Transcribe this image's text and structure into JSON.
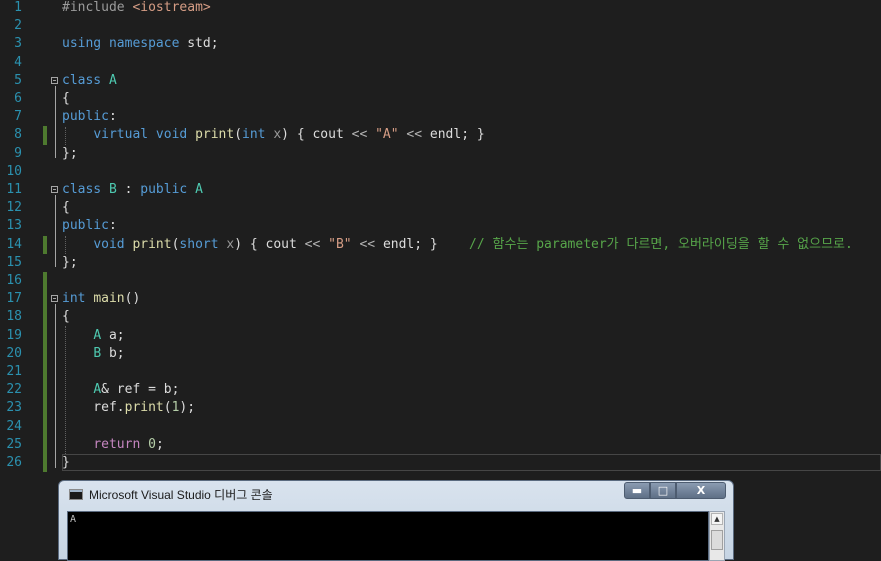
{
  "editor": {
    "line_numbers": [
      "1",
      "2",
      "3",
      "4",
      "5",
      "6",
      "7",
      "8",
      "9",
      "10",
      "11",
      "12",
      "13",
      "14",
      "15",
      "16",
      "17",
      "18",
      "19",
      "20",
      "21",
      "22",
      "23",
      "24",
      "25",
      "26"
    ],
    "lines": [
      [
        {
          "t": "#include ",
          "c": "pp"
        },
        {
          "t": "<iostream>",
          "c": "in"
        }
      ],
      [],
      [
        {
          "t": "using namespace ",
          "c": "kw"
        },
        {
          "t": "std;",
          "c": ""
        }
      ],
      [],
      [
        {
          "t": "class ",
          "c": "kw"
        },
        {
          "t": "A",
          "c": "ty"
        }
      ],
      [
        {
          "t": "{",
          "c": ""
        }
      ],
      [
        {
          "t": "public",
          "c": "kw"
        },
        {
          "t": ":",
          "c": ""
        }
      ],
      [
        {
          "t": "    ",
          "c": ""
        },
        {
          "t": "virtual void ",
          "c": "kw"
        },
        {
          "t": "print",
          "c": "fn"
        },
        {
          "t": "(",
          "c": ""
        },
        {
          "t": "int ",
          "c": "kw"
        },
        {
          "t": "x",
          "c": "pa"
        },
        {
          "t": ") { cout ",
          "c": ""
        },
        {
          "t": "<<",
          "c": "op"
        },
        {
          "t": " ",
          "c": ""
        },
        {
          "t": "\"A\"",
          "c": "st"
        },
        {
          "t": " ",
          "c": ""
        },
        {
          "t": "<<",
          "c": "op"
        },
        {
          "t": " endl; }",
          "c": ""
        }
      ],
      [
        {
          "t": "};",
          "c": ""
        }
      ],
      [],
      [
        {
          "t": "class ",
          "c": "kw"
        },
        {
          "t": "B",
          "c": "ty"
        },
        {
          "t": " : ",
          "c": ""
        },
        {
          "t": "public ",
          "c": "kw"
        },
        {
          "t": "A",
          "c": "ty"
        }
      ],
      [
        {
          "t": "{",
          "c": ""
        }
      ],
      [
        {
          "t": "public",
          "c": "kw"
        },
        {
          "t": ":",
          "c": ""
        }
      ],
      [
        {
          "t": "    ",
          "c": ""
        },
        {
          "t": "void ",
          "c": "kw"
        },
        {
          "t": "print",
          "c": "fn"
        },
        {
          "t": "(",
          "c": ""
        },
        {
          "t": "short ",
          "c": "kw"
        },
        {
          "t": "x",
          "c": "pa"
        },
        {
          "t": ") { cout ",
          "c": ""
        },
        {
          "t": "<<",
          "c": "op"
        },
        {
          "t": " ",
          "c": ""
        },
        {
          "t": "\"B\"",
          "c": "st"
        },
        {
          "t": " ",
          "c": ""
        },
        {
          "t": "<<",
          "c": "op"
        },
        {
          "t": " endl; }    ",
          "c": ""
        },
        {
          "t": "// 함수는 parameter가 다르면, 오버라이딩을 할 수 없으므로.",
          "c": "cm"
        }
      ],
      [
        {
          "t": "};",
          "c": ""
        }
      ],
      [],
      [
        {
          "t": "int ",
          "c": "kw"
        },
        {
          "t": "main",
          "c": "fn"
        },
        {
          "t": "()",
          "c": ""
        }
      ],
      [
        {
          "t": "{",
          "c": ""
        }
      ],
      [
        {
          "t": "    ",
          "c": ""
        },
        {
          "t": "A",
          "c": "ty"
        },
        {
          "t": " a;",
          "c": ""
        }
      ],
      [
        {
          "t": "    ",
          "c": ""
        },
        {
          "t": "B",
          "c": "ty"
        },
        {
          "t": " b;",
          "c": ""
        }
      ],
      [],
      [
        {
          "t": "    ",
          "c": ""
        },
        {
          "t": "A",
          "c": "ty"
        },
        {
          "t": "& ref = b;",
          "c": ""
        }
      ],
      [
        {
          "t": "    ref.",
          "c": ""
        },
        {
          "t": "print",
          "c": "fn"
        },
        {
          "t": "(",
          "c": ""
        },
        {
          "t": "1",
          "c": "nu"
        },
        {
          "t": ");",
          "c": ""
        }
      ],
      [],
      [
        {
          "t": "    ",
          "c": ""
        },
        {
          "t": "return ",
          "c": "ex"
        },
        {
          "t": "0",
          "c": "nu"
        },
        {
          "t": ";",
          "c": ""
        }
      ],
      [
        {
          "t": "}",
          "c": ""
        }
      ]
    ],
    "changed_lines": [
      8,
      14,
      16,
      17,
      18,
      19,
      20,
      21,
      22,
      23,
      24,
      25,
      26
    ]
  },
  "console": {
    "title": "Microsoft Visual Studio 디버그 콘솔",
    "output": "A",
    "buttons": {
      "minimize": "▬",
      "maximize": "□",
      "close": "X"
    },
    "scroll_up": "▲"
  }
}
